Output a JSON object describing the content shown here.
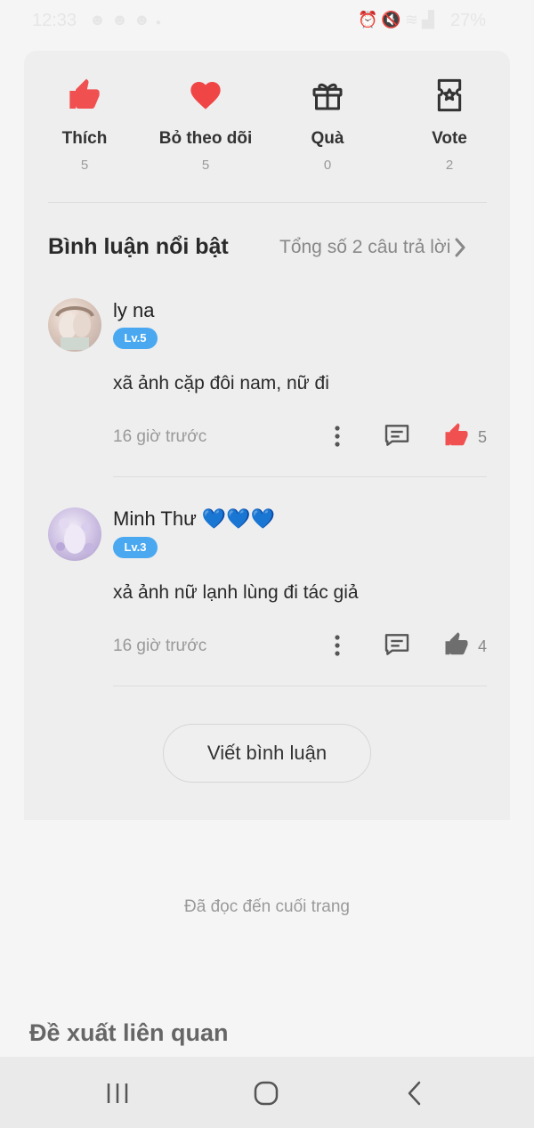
{
  "status_bar": {
    "time": "12:33",
    "battery": "27%",
    "left_icons": [
      "notification-icon",
      "notification-icon",
      "notification-icon",
      "dot-icon"
    ],
    "right_icons": [
      "alarm-icon",
      "mute-icon",
      "wifi-icon",
      "signal-icon"
    ]
  },
  "actions": [
    {
      "label": "Thích",
      "count": "5",
      "icon": "thumbs-up-icon",
      "color": "#f05050"
    },
    {
      "label": "Bỏ theo dõi",
      "count": "5",
      "icon": "heart-icon",
      "color": "#f04545"
    },
    {
      "label": "Quà",
      "count": "0",
      "icon": "gift-icon",
      "color": "#333333"
    },
    {
      "label": "Vote",
      "count": "2",
      "icon": "vote-ticket-icon",
      "color": "#333333"
    }
  ],
  "comments_section": {
    "title": "Bình luận nổi bật",
    "total_link": "Tổng số 2 câu trả lời"
  },
  "comments": [
    {
      "user": "ly na",
      "level": "Lv.5",
      "text": "xã ảnh cặp đôi nam, nữ đi",
      "time": "16 giờ trước",
      "likes": "5",
      "liked": true
    },
    {
      "user": "Minh Thư 💙💙💙",
      "level": "Lv.3",
      "text": "xả ảnh nữ lạnh lùng đi tác giả",
      "time": "16 giờ trước",
      "likes": "4",
      "liked": false
    }
  ],
  "write_comment_label": "Viết bình luận",
  "end_of_page_text": "Đã đọc đến cuối trang",
  "related_title": "Đề xuất liên quan",
  "colors": {
    "accent_like": "#f05050",
    "badge": "#4aa8f0",
    "card_bg": "#eeeeee"
  }
}
